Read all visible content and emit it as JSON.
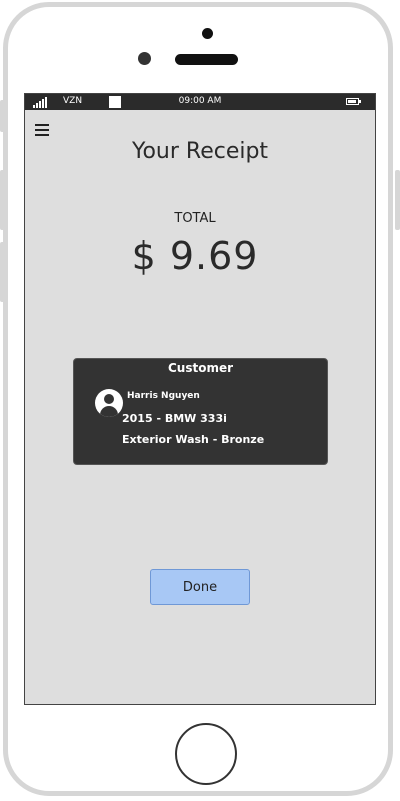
{
  "status_bar": {
    "carrier": "VZN",
    "time": "09:00 AM"
  },
  "page": {
    "title": "Your Receipt",
    "total_label": "TOTAL",
    "total_amount": "$ 9.69"
  },
  "customer_card": {
    "title": "Customer",
    "name": "Harris Nguyen",
    "vehicle": "2015 - BMW 333i",
    "service": "Exterior Wash - Bronze"
  },
  "actions": {
    "done_label": "Done"
  },
  "icons": {
    "menu": "hamburger-menu-icon",
    "avatar": "user-avatar-icon",
    "signal": "signal-strength-icon",
    "battery": "battery-icon"
  },
  "colors": {
    "screen_bg": "#dedede",
    "status_bar_bg": "#2b2b2b",
    "card_bg": "#333333",
    "done_button_bg": "#a8c8f5"
  }
}
